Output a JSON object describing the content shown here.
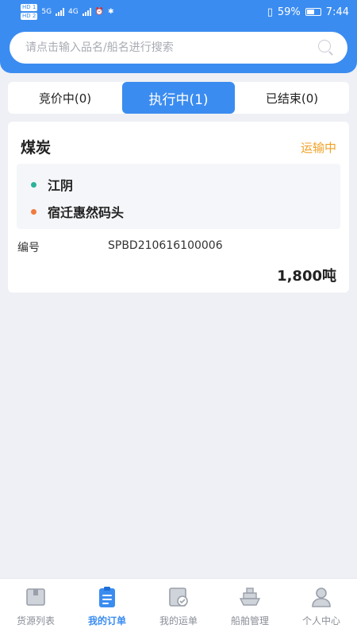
{
  "status_bar": {
    "hd1": "HD 1",
    "hd2": "HD 2",
    "net1": "5G",
    "net2": "4G",
    "battery_pct": "59%",
    "time": "7:44"
  },
  "search": {
    "placeholder": "请点击输入品名/船名进行搜索",
    "icon": "search-icon"
  },
  "tabs": [
    {
      "label": "竞价中(0)",
      "active": false
    },
    {
      "label": "执行中(1)",
      "active": true
    },
    {
      "label": "已结束(0)",
      "active": false
    }
  ],
  "order": {
    "product": "煤炭",
    "status": "运输中",
    "status_color": "#f0a024",
    "origin": "江阴",
    "destination": "宿迁惠然码头",
    "number_label": "编号",
    "number_value": "SPBD210616100006",
    "weight": "1,800吨"
  },
  "bottom_nav": [
    {
      "label": "货源列表",
      "icon": "cargo-box-icon",
      "active": false
    },
    {
      "label": "我的订单",
      "icon": "clipboard-icon",
      "active": true
    },
    {
      "label": "我的运单",
      "icon": "waybill-icon",
      "active": false
    },
    {
      "label": "船舶管理",
      "icon": "ship-icon",
      "active": false
    },
    {
      "label": "个人中心",
      "icon": "person-icon",
      "active": false
    }
  ],
  "colors": {
    "primary": "#3b8cf0",
    "accent_orange": "#f0a024",
    "dot_green": "#2bb39a",
    "dot_orange": "#f07b3f"
  }
}
